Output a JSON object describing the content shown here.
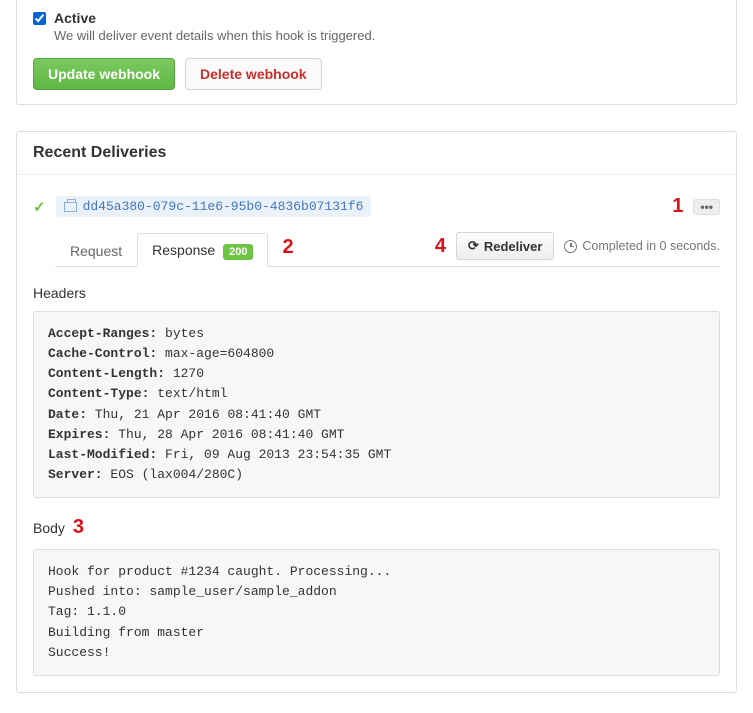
{
  "active": {
    "label": "Active",
    "desc": "We will deliver event details when this hook is triggered.",
    "checked": true
  },
  "buttons": {
    "update": "Update webhook",
    "delete": "Delete webhook",
    "redeliver": "Redeliver",
    "dots": "•••"
  },
  "deliveries": {
    "title": "Recent Deliveries",
    "id": "dd45a380-079c-11e6-95b0-4836b07131f6",
    "tabs": {
      "request": "Request",
      "response": "Response",
      "status": "200"
    },
    "completed": "Completed in 0 seconds."
  },
  "headers": {
    "label": "Headers",
    "items": [
      {
        "k": "Accept-Ranges",
        "v": "bytes"
      },
      {
        "k": "Cache-Control",
        "v": "max-age=604800"
      },
      {
        "k": "Content-Length",
        "v": "1270"
      },
      {
        "k": "Content-Type",
        "v": "text/html"
      },
      {
        "k": "Date",
        "v": "Thu, 21 Apr 2016 08:41:40 GMT"
      },
      {
        "k": "Expires",
        "v": "Thu, 28 Apr 2016 08:41:40 GMT"
      },
      {
        "k": "Last-Modified",
        "v": "Fri, 09 Aug 2013 23:54:35 GMT"
      },
      {
        "k": "Server",
        "v": "EOS (lax004/280C)"
      }
    ]
  },
  "body": {
    "label": "Body",
    "content": "Hook for product #1234 caught. Processing...\nPushed into: sample_user/sample_addon\nTag: 1.1.0\nBuilding from master\nSuccess!"
  },
  "annotations": {
    "a1": "1",
    "a2": "2",
    "a3": "3",
    "a4": "4"
  }
}
